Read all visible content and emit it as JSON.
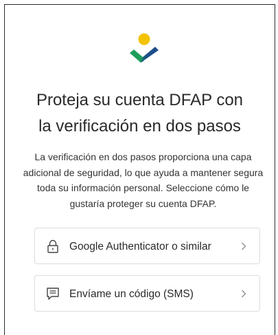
{
  "brand": {
    "logo_colors": {
      "dot": "#F3C200",
      "check_left": "#1E9E5A",
      "check_right": "#1D4E89"
    }
  },
  "title": "Proteja su cuenta DFAP con\nla verificación en dos pasos",
  "description": "La verificación en dos pasos proporciona una capa adicional de seguridad, lo que ayuda a mantener segura toda su información personal. Seleccione cómo le gustaría proteger su cuenta DFAP.",
  "options": [
    {
      "icon": "lock-icon",
      "label": "Google Authenticator o similar"
    },
    {
      "icon": "sms-message-icon",
      "label": "Envíame un código (SMS)"
    }
  ]
}
